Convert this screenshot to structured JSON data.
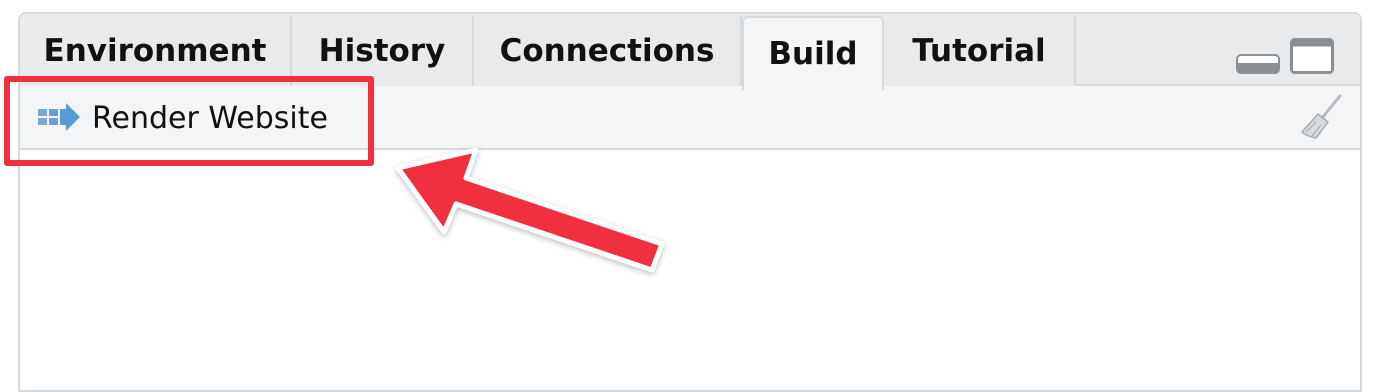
{
  "tabs": [
    {
      "label": "Environment"
    },
    {
      "label": "History"
    },
    {
      "label": "Connections"
    },
    {
      "label": "Build",
      "active": true
    },
    {
      "label": "Tutorial"
    }
  ],
  "toolbar": {
    "render_label": "Render Website",
    "render_icon": "arrow-build-icon",
    "clear_icon": "broom-icon"
  },
  "window_controls": [
    "minimize-icon",
    "maximize-icon"
  ],
  "colors": {
    "annotation": "#f0303e",
    "tab_bg": "#e8eaeb",
    "active_tab_bg": "#f4f5f6",
    "border": "#d6dadc",
    "icon_blue": "#5b9bd5"
  }
}
